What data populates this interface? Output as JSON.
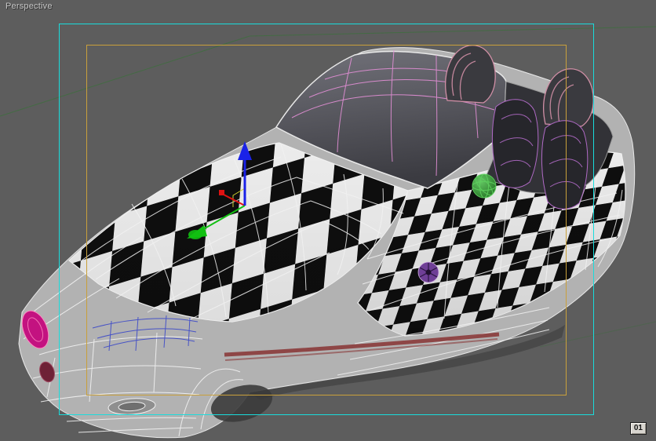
{
  "viewport": {
    "label": "Perspective",
    "frame_badge": "01"
  },
  "colors": {
    "background": "#5d5d5d",
    "label_text": "#c8c8c8",
    "safe_frame_outer": "#19dcdc",
    "safe_frame_inner": "#c9a03b",
    "grid": "#3e703e",
    "wire_white": "#f2f2f2",
    "body_gray": "#b2b2b2",
    "body_outline": "#e8e8e8",
    "checker_light": "#ececec",
    "checker_dark": "#0e0e0e",
    "glass_wire_pink": "#e38fd6",
    "seat_wire_purple": "#b06ac6",
    "rollbar_wire": "#d18fa6",
    "rollbar_dark": "#3a3a3f",
    "cockpit_dark": "#323237",
    "seat_dark": "#26262b",
    "front_wire_blue": "#3c49c8",
    "headlight_magenta": "#c31280",
    "headlight_rim": "#ff8ac2",
    "marker_red": "#6e2136",
    "emblem_purple": "#6f3f96",
    "sphere_green": "#2e8f2e",
    "sphere_wire": "#5fd05f",
    "gizmo_x": "#e01212",
    "gizmo_y": "#12c012",
    "gizmo_z": "#1a22e8",
    "gizmo_plane": "#cfcf30",
    "sill_maroon": "#8a3a3a",
    "shadow": "#454545",
    "badge_bg": "#d8d5cf",
    "badge_text": "#141414"
  }
}
